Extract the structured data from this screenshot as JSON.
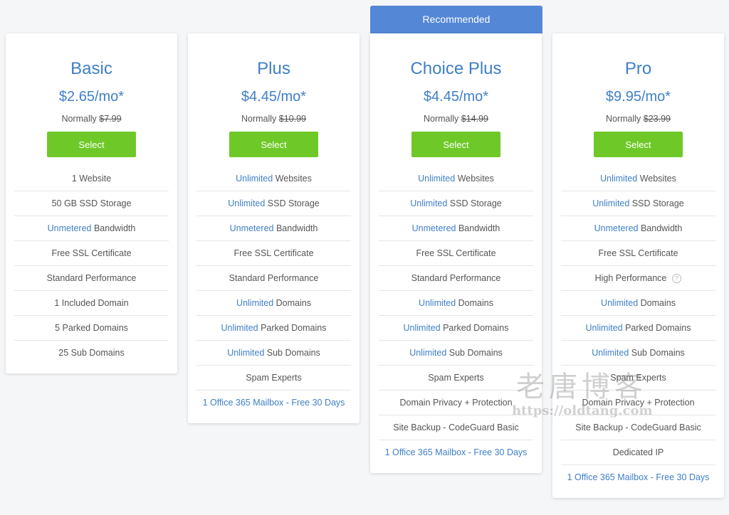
{
  "banner": {
    "label": "Recommended"
  },
  "plans": [
    {
      "name": "Basic",
      "price": "$2.65/mo*",
      "normally_label": "Normally",
      "old_price": "$7.99",
      "select_label": "Select",
      "features": [
        {
          "hl": "",
          "text": "1 Website"
        },
        {
          "hl": "",
          "text": "50 GB SSD Storage"
        },
        {
          "hl": "Unmetered",
          "text": " Bandwidth"
        },
        {
          "hl": "",
          "text": "Free SSL Certificate"
        },
        {
          "hl": "",
          "text": "Standard Performance"
        },
        {
          "hl": "",
          "text": "1 Included Domain"
        },
        {
          "hl": "",
          "text": "5 Parked Domains"
        },
        {
          "hl": "",
          "text": "25 Sub Domains"
        }
      ]
    },
    {
      "name": "Plus",
      "price": "$4.45/mo*",
      "normally_label": "Normally",
      "old_price": "$10.99",
      "select_label": "Select",
      "features": [
        {
          "hl": "Unlimited",
          "text": " Websites"
        },
        {
          "hl": "Unlimited",
          "text": " SSD Storage"
        },
        {
          "hl": "Unmetered",
          "text": " Bandwidth"
        },
        {
          "hl": "",
          "text": "Free SSL Certificate"
        },
        {
          "hl": "",
          "text": "Standard Performance"
        },
        {
          "hl": "Unlimited",
          "text": " Domains"
        },
        {
          "hl": "Unlimited",
          "text": " Parked Domains"
        },
        {
          "hl": "Unlimited",
          "text": " Sub Domains"
        },
        {
          "hl": "",
          "text": "Spam Experts"
        },
        {
          "hl": "",
          "text": "",
          "link": "1 Office 365 Mailbox - Free 30 Days"
        }
      ]
    },
    {
      "name": "Choice Plus",
      "price": "$4.45/mo*",
      "normally_label": "Normally",
      "old_price": "$14.99",
      "select_label": "Select",
      "features": [
        {
          "hl": "Unlimited",
          "text": " Websites"
        },
        {
          "hl": "Unlimited",
          "text": " SSD Storage"
        },
        {
          "hl": "Unmetered",
          "text": " Bandwidth"
        },
        {
          "hl": "",
          "text": "Free SSL Certificate"
        },
        {
          "hl": "",
          "text": "Standard Performance"
        },
        {
          "hl": "Unlimited",
          "text": " Domains"
        },
        {
          "hl": "Unlimited",
          "text": " Parked Domains"
        },
        {
          "hl": "Unlimited",
          "text": " Sub Domains"
        },
        {
          "hl": "",
          "text": "Spam Experts"
        },
        {
          "hl": "",
          "text": "Domain Privacy + Protection"
        },
        {
          "hl": "",
          "text": "Site Backup - CodeGuard Basic"
        },
        {
          "hl": "",
          "text": "",
          "link": "1 Office 365 Mailbox - Free 30 Days"
        }
      ]
    },
    {
      "name": "Pro",
      "price": "$9.95/mo*",
      "normally_label": "Normally",
      "old_price": "$23.99",
      "select_label": "Select",
      "features": [
        {
          "hl": "Unlimited",
          "text": " Websites"
        },
        {
          "hl": "Unlimited",
          "text": " SSD Storage"
        },
        {
          "hl": "Unmetered",
          "text": " Bandwidth"
        },
        {
          "hl": "",
          "text": "Free SSL Certificate"
        },
        {
          "hl": "",
          "text": "High Performance",
          "help": "?"
        },
        {
          "hl": "Unlimited",
          "text": " Domains"
        },
        {
          "hl": "Unlimited",
          "text": " Parked Domains"
        },
        {
          "hl": "Unlimited",
          "text": " Sub Domains"
        },
        {
          "hl": "",
          "text": "Spam Experts"
        },
        {
          "hl": "",
          "text": "Domain Privacy + Protection"
        },
        {
          "hl": "",
          "text": "Site Backup - CodeGuard Basic"
        },
        {
          "hl": "",
          "text": "Dedicated IP"
        },
        {
          "hl": "",
          "text": "",
          "link": "1 Office 365 Mailbox - Free 30 Days"
        }
      ]
    }
  ],
  "watermark": {
    "title": "老唐博客",
    "url": "https://oldtang.com"
  },
  "colors": {
    "accent": "#3f7fc7",
    "button": "#6ec928",
    "banner": "#5487d6"
  }
}
